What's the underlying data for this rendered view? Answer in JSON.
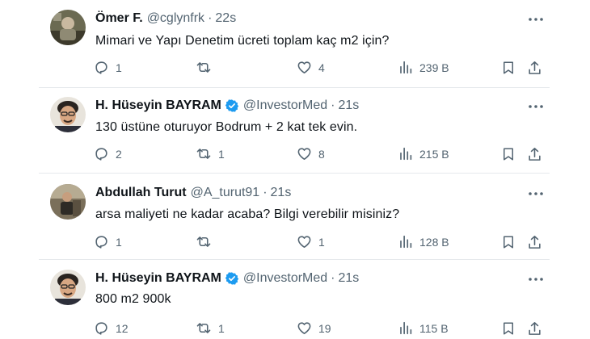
{
  "tweets": [
    {
      "name": "Ömer F.",
      "handle": "@cglynfrk",
      "time": "22s",
      "verified": false,
      "text": "Mimari ve Yapı Denetim ücreti toplam kaç m2 için?",
      "replies": "1",
      "retweets": "",
      "likes": "4",
      "views": "239 B"
    },
    {
      "name": "H. Hüseyin BAYRAM",
      "handle": "@InvestorMed",
      "time": "21s",
      "verified": true,
      "text": "130 üstüne oturuyor Bodrum + 2 kat tek evin.",
      "replies": "2",
      "retweets": "1",
      "likes": "8",
      "views": "215 B"
    },
    {
      "name": "Abdullah Turut",
      "handle": "@A_turut91",
      "time": "21s",
      "verified": false,
      "text": "arsa maliyeti ne kadar acaba? Bilgi verebilir misiniz?",
      "replies": "1",
      "retweets": "",
      "likes": "1",
      "views": "128 B"
    },
    {
      "name": "H. Hüseyin BAYRAM",
      "handle": "@InvestorMed",
      "time": "21s",
      "verified": true,
      "text": "800 m2 900k",
      "replies": "12",
      "retweets": "1",
      "likes": "19",
      "views": "115 B"
    }
  ],
  "separator": "·",
  "icons": {
    "reply": "reply-icon",
    "retweet": "retweet-icon",
    "like": "heart-icon",
    "views": "views-icon",
    "bookmark": "bookmark-icon",
    "share": "share-icon",
    "more": "more-icon",
    "verified": "verified-badge-icon"
  },
  "colors": {
    "text": "#0f1419",
    "secondary": "#536471",
    "verified": "#1d9bf0",
    "divider": "#e6e9ec"
  }
}
